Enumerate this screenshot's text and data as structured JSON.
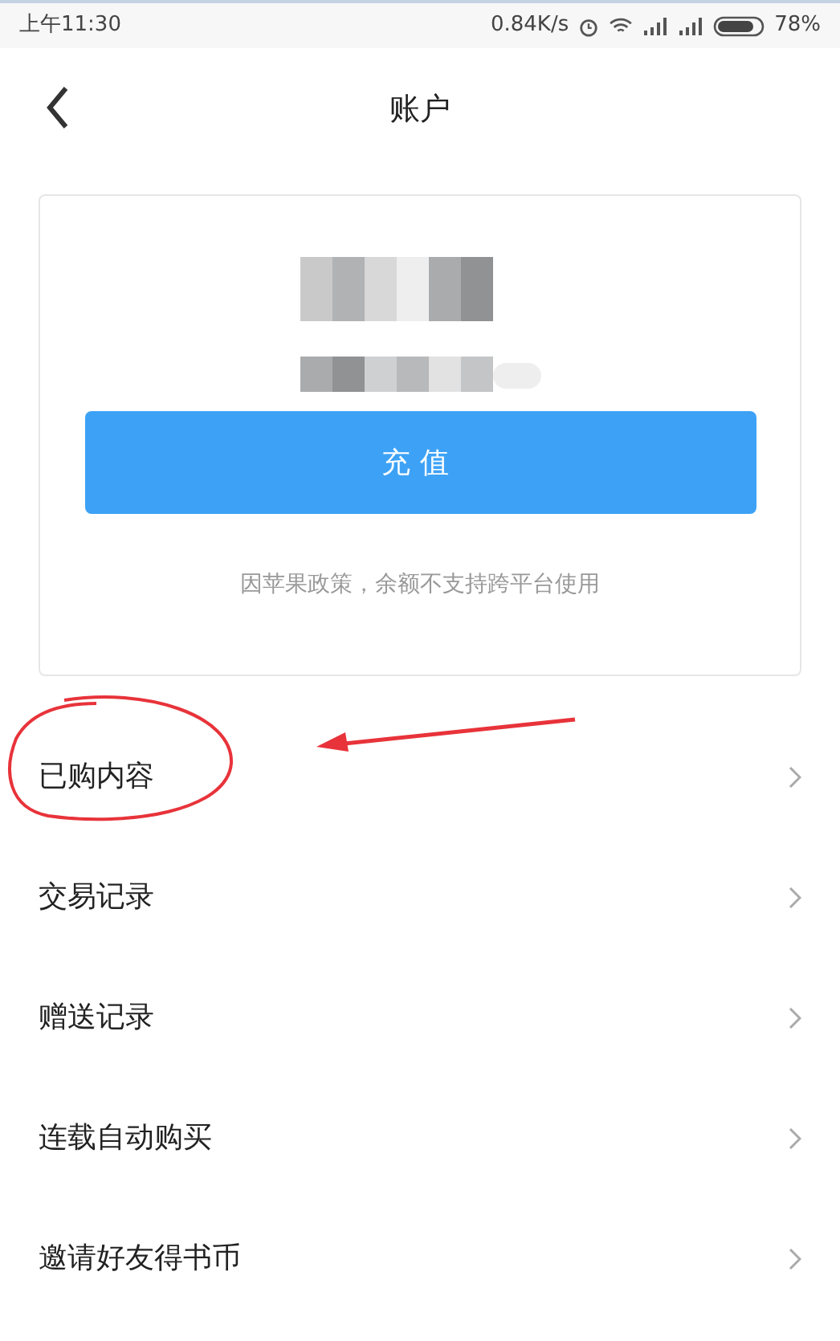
{
  "status_bar": {
    "time": "上午11:30",
    "network_speed": "0.84K/s",
    "battery": "78%"
  },
  "header": {
    "title": "账户"
  },
  "balance_card": {
    "button": "充值",
    "note": "因苹果政策，余额不支持跨平台使用"
  },
  "menu": [
    {
      "label": "已购内容"
    },
    {
      "label": "交易记录"
    },
    {
      "label": "赠送记录"
    },
    {
      "label": "连载自动购买"
    },
    {
      "label": "邀请好友得书币"
    }
  ]
}
